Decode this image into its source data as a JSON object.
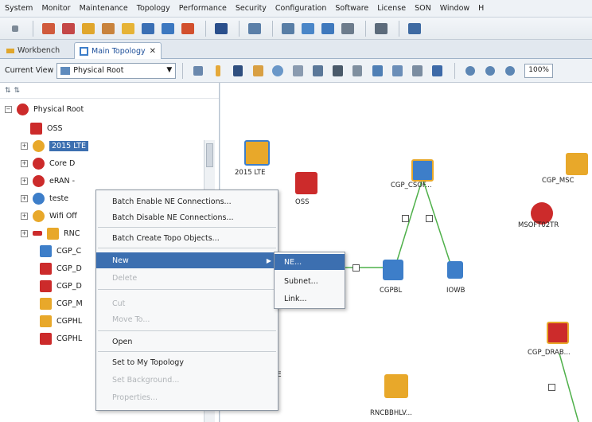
{
  "menubar": [
    "System",
    "Monitor",
    "Maintenance",
    "Topology",
    "Performance",
    "Security",
    "Configuration",
    "Software",
    "License",
    "SON",
    "Window",
    "H"
  ],
  "tabs": {
    "workbench": "Workbench",
    "main_topology": "Main Topology"
  },
  "view": {
    "label": "Current View",
    "selected": "Physical Root",
    "zoom": "100%"
  },
  "tree": {
    "root": "Physical Root",
    "items": [
      {
        "label": "OSS",
        "color": "#cc2b2b"
      },
      {
        "label": "2015 LTE",
        "color": "#e8a82a",
        "selected": true
      },
      {
        "label": "Core D",
        "color": "#cc2b2b"
      },
      {
        "label": "eRAN -",
        "color": "#cc2b2b"
      },
      {
        "label": "teste",
        "color": "#3d7ec9"
      },
      {
        "label": "Wifi Off",
        "color": "#e8a82a"
      },
      {
        "label": "RNC",
        "color": "#e8a82a"
      },
      {
        "label": "CGP_C",
        "color": "#3d7ec9"
      },
      {
        "label": "CGP_D",
        "color": "#cc2b2b"
      },
      {
        "label": "CGP_D",
        "color": "#cc2b2b"
      },
      {
        "label": "CGP_M",
        "color": "#e8a82a"
      },
      {
        "label": "CGPHL",
        "color": "#e8a82a"
      },
      {
        "label": "CGPHL",
        "color": "#cc2b2b"
      }
    ]
  },
  "canvas": {
    "nodes": [
      {
        "label": "2015 LTE"
      },
      {
        "label": "OSS"
      },
      {
        "label": "CGP_CSOF..."
      },
      {
        "label": "CGP_MSC"
      },
      {
        "label": "MSOFT02TR"
      },
      {
        "label": "CGPBL"
      },
      {
        "label": "IOWB"
      },
      {
        "label": "CGP_DRAB..."
      },
      {
        "label": "RNCBBHLV..."
      },
      {
        "label": "TE"
      }
    ]
  },
  "context_menu": {
    "items": [
      {
        "label": "Batch Enable NE Connections...",
        "enabled": true
      },
      {
        "label": "Batch Disable NE Connections...",
        "enabled": true
      },
      {
        "label": "Batch Create Topo Objects...",
        "enabled": true
      },
      {
        "label": "New",
        "enabled": true,
        "highlighted": true,
        "submenu_arrow": "▶"
      },
      {
        "label": "Delete",
        "enabled": false
      },
      {
        "label": "Cut",
        "enabled": false
      },
      {
        "label": "Move To...",
        "enabled": false
      },
      {
        "label": "Open",
        "enabled": true
      },
      {
        "label": "Set to My Topology",
        "enabled": true
      },
      {
        "label": "Set Background...",
        "enabled": false
      },
      {
        "label": "Properties...",
        "enabled": false
      }
    ],
    "submenu": [
      {
        "label": "NE...",
        "highlighted": true
      },
      {
        "label": "Subnet..."
      },
      {
        "label": "Link..."
      }
    ]
  },
  "colors": {
    "accent": "#3c6fb0",
    "ne_red": "#cc2b2b",
    "ne_orange": "#e8a82a",
    "ne_blue": "#3d7ec9",
    "link_green": "#4fb04a"
  }
}
